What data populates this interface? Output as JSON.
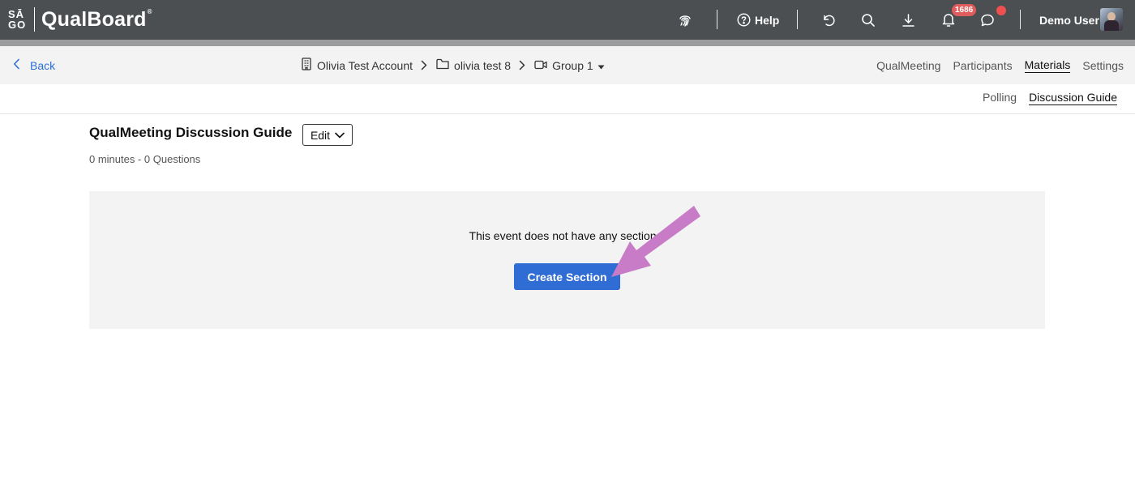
{
  "brand": {
    "mark_top": "SĀ",
    "mark_bottom": "GO",
    "name": "QualBoard",
    "trademark": "®"
  },
  "header": {
    "help_label": "Help",
    "notification_count": "1686",
    "user_name": "Demo User",
    "icons": [
      "fingerprint-icon",
      "help-icon",
      "undo-icon",
      "search-icon",
      "download-icon",
      "bell-icon",
      "chat-icon"
    ]
  },
  "subnav": {
    "back_label": "Back",
    "breadcrumbs": [
      {
        "label": "Olivia Test Account",
        "icon": "building-icon"
      },
      {
        "label": "olivia test 8",
        "icon": "folder-icon"
      },
      {
        "label": "Group 1",
        "icon": "video-camera-icon"
      }
    ],
    "tabs": [
      {
        "label": "QualMeeting",
        "active": false
      },
      {
        "label": "Participants",
        "active": false
      },
      {
        "label": "Materials",
        "active": true
      },
      {
        "label": "Settings",
        "active": false
      }
    ]
  },
  "subtabs": [
    {
      "label": "Polling",
      "active": false
    },
    {
      "label": "Discussion Guide",
      "active": true
    }
  ],
  "main": {
    "title": "QualMeeting Discussion Guide",
    "edit_label": "Edit",
    "meta": "0 minutes - 0 Questions",
    "empty_message": "This event does not have any sections.",
    "create_label": "Create Section"
  },
  "colors": {
    "header_bg": "#4b4f52",
    "accent_blue": "#2f6cd3",
    "badge_red": "#e05d5d",
    "annotation_arrow": "#c87cc8"
  }
}
